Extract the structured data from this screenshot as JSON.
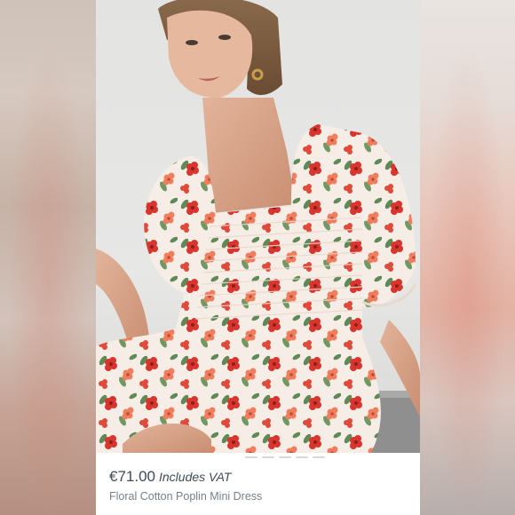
{
  "listing": {
    "price": "€71.00",
    "price_note": "Includes VAT",
    "title": "Floral Cotton Poplin Mini Dress"
  },
  "image": {
    "subject": "model-in-floral-dress",
    "icon": "product-photo"
  },
  "colors": {
    "background_band": "#d2c3bb",
    "dress_base": "#f6eee6",
    "flower_red": "#d8352e",
    "flower_coral": "#ef7e5f",
    "leaf_green": "#5f8a57",
    "price_text": "#3f4a55",
    "title_text": "#77808a"
  }
}
